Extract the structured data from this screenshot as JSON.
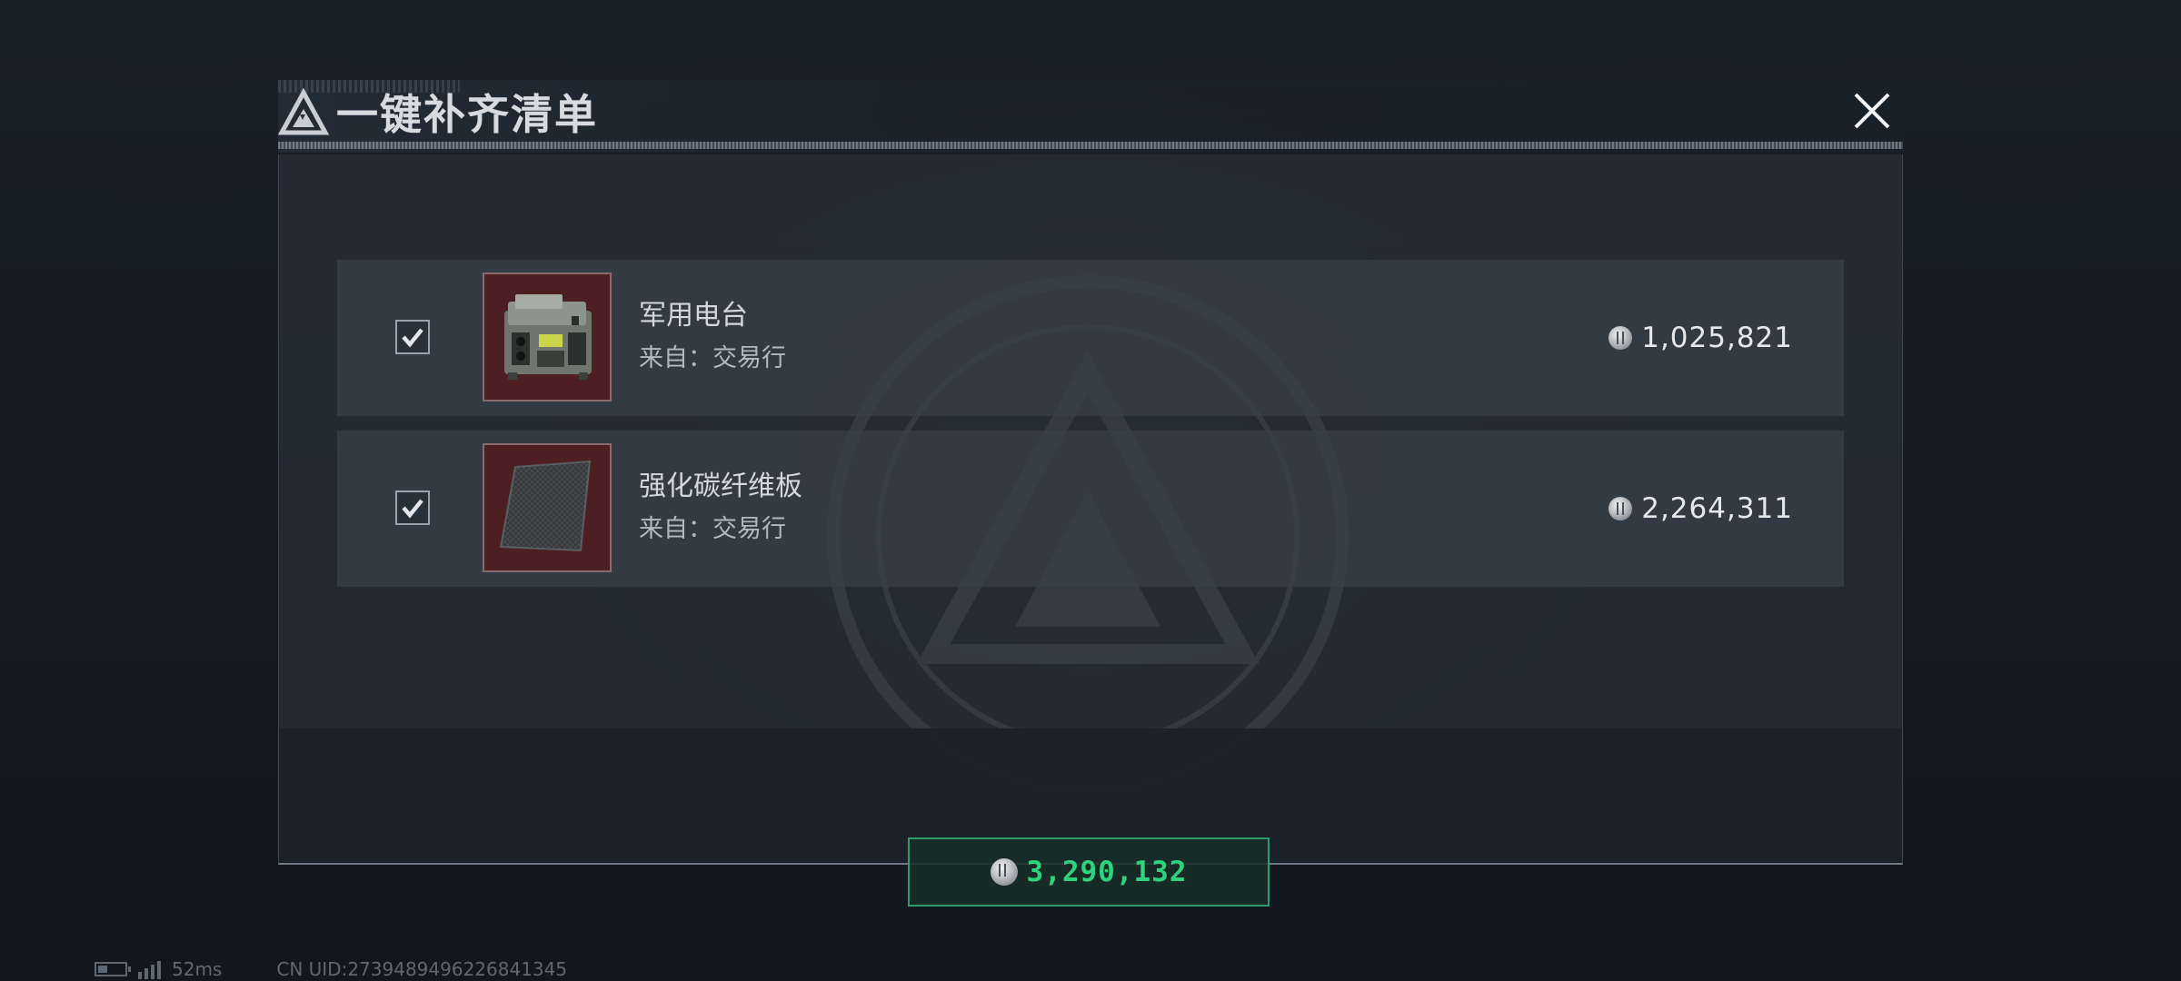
{
  "dialog": {
    "title": "一键补齐清单",
    "close_icon": "close-icon",
    "logo_icon": "triangle-logo-icon"
  },
  "items": [
    {
      "name": "军用电台",
      "source": "来自：交易行",
      "price": "1,025,821",
      "checked": true,
      "icon": "military-radio-icon"
    },
    {
      "name": "强化碳纤维板",
      "source": "来自：交易行",
      "price": "2,264,311",
      "checked": true,
      "icon": "carbon-fiber-plate-icon"
    }
  ],
  "total": {
    "value": "3,290,132",
    "color": "#2fd37f"
  },
  "status": {
    "ping": "52ms",
    "uid": "CN UID:2739489496226841345"
  },
  "colors": {
    "accent_green": "#2fd37f",
    "item_bg": "#4e1f22"
  }
}
